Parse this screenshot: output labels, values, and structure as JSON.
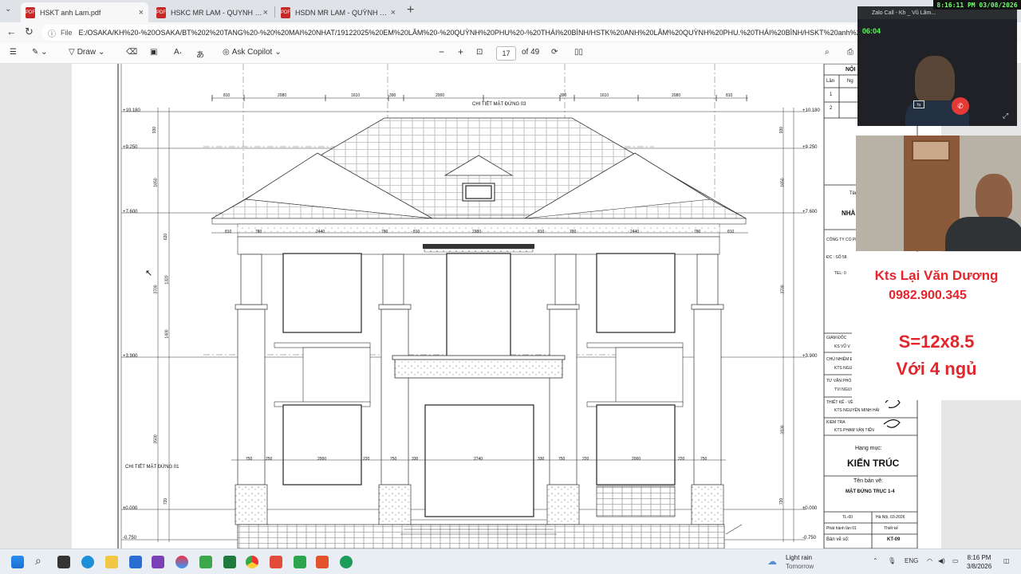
{
  "tabs": [
    {
      "label": "HSKT anh Lam.pdf",
      "active": true
    },
    {
      "label": "HSKC MR LAM - QUYNH PHU - Tr",
      "active": false
    },
    {
      "label": "HSDN MR LAM - QUỲNH PHU - Tr",
      "active": false
    }
  ],
  "address": {
    "scheme": "File",
    "url": "E:/OSAKA/KH%20-%20OSAKA/BT%202%20TANG%20-%20%20MAI%20NHAT/19122025%20EM%20LÂM%20-%20QUỲNH%20PHU%20-%20THÁI%20BÌNH/HSTK%20ANH%20LÂM%20QUỲNH%20PHU.%20THÁI%20BÌNH/HSKT%20anh%20Lam"
  },
  "pdf_toolbar": {
    "draw_label": "Draw",
    "copilot_label": "Ask Copilot",
    "page_current": "17",
    "page_total": "of 49"
  },
  "drawing": {
    "detail_top": "CHI TIẾT MẶT ĐỨNG 03",
    "detail_left": "CHI TIẾT MẶT ĐỨNG 01",
    "levels": [
      "+10.180",
      "+9.250",
      "+7.600",
      "+3.900",
      "±0.000",
      "-0.750"
    ],
    "top_dims": [
      "810",
      "2080",
      "1610",
      "390",
      "2000",
      "390",
      "1610",
      "2080",
      "810"
    ],
    "mid_dims": [
      "810",
      "780",
      "2440",
      "780",
      "810",
      "2380",
      "810",
      "780",
      "2440",
      "780",
      "810"
    ],
    "bottom_dims": [
      "750",
      "250",
      "2000",
      "220",
      "750",
      "330",
      "2740",
      "330",
      "750",
      "220",
      "2000",
      "220",
      "750"
    ],
    "vert_dims_left": [
      "930",
      "1650",
      "620",
      "1320",
      "1400",
      "3700",
      "3500",
      "720"
    ],
    "vert_dims_right": [
      "930",
      "1650",
      "3700",
      "3100",
      "720"
    ]
  },
  "title_block": {
    "header": "NỘI",
    "col_lan": "Lần",
    "col_ngay": "Ng",
    "row1": "1",
    "row2": "2",
    "ten_label": "Tên",
    "nha": "NHÀ",
    "cong_ty": "CÔNG TY CỔ PH",
    "dc": "ĐC : SỐ 58",
    "tel": "TEL: 0",
    "giam_doc": "GIÁM ĐỐC",
    "gd_name": "KS VŨ V",
    "chu_nhiem": "CHỦ NHIỆM Đ",
    "cn_name": "KTS NGUY",
    "tu_van": "TƯ VẤN PHÓ",
    "tv_name": "TVI NGUY",
    "thiet_ke": "THIẾT KẾ - VẼ",
    "tk_name": "KTS NGUYỄN MINH HẢI",
    "kiem_tra": "KIỂM TRA",
    "kt_name": "KTS PHẠM VĂN TIẾN",
    "hang_muc": "Hạng mục:",
    "kien_truc": "KIẾN TRÚC",
    "ten_ban_ve": "Tên bản vẽ:",
    "ban_ve_name": "MẶT ĐỨNG TRỤC 1-4",
    "tl": "TL-00",
    "ha_noi": "Hà Nội, 03-2026",
    "phat_hanh": "Phát hành lần 01",
    "thiet_ke2": "Thiết kế",
    "ban_ve_so": "Bản vẽ số:",
    "kt09": "KT-09"
  },
  "video_call": {
    "title": "Zalo Call - Kh _ Vũ Lâm...",
    "elapsed": "06:04",
    "clock_overlay": "8:16:11 PM 03/08/2026"
  },
  "overlay": {
    "name": "Kts Lại Văn Dương",
    "phone": "0982.900.345",
    "area": "S=12x8.5",
    "rooms": "Với 4 ngủ"
  },
  "taskbar": {
    "weather_title": "Light rain",
    "weather_sub": "Tomorrow",
    "lang": "ENG",
    "time": "8:16 PM",
    "date": "3/8/2026"
  },
  "colors": {
    "overlay_red": "#e3262b",
    "tab_bg": "#dfe3e8",
    "taskbar_bg": "#e9eef4"
  }
}
